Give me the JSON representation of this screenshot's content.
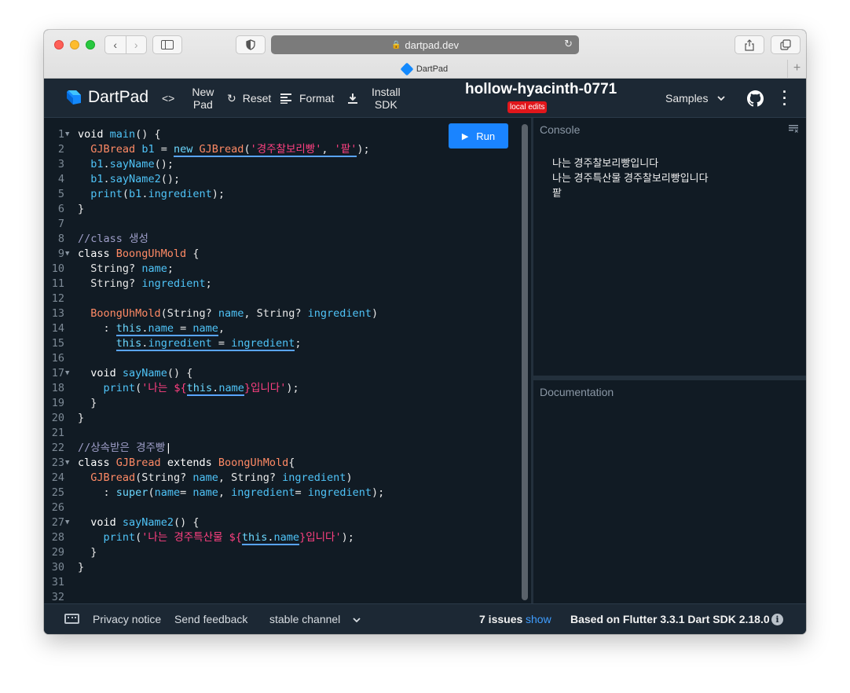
{
  "browser": {
    "url": "dartpad.dev",
    "tab_title": "DartPad",
    "new_tab_label": "+"
  },
  "appbar": {
    "logo_text": "DartPad",
    "new_pad_line1": "New",
    "new_pad_line2": "Pad",
    "reset_label": "Reset",
    "format_label": "Format",
    "install_line1": "Install",
    "install_line2": "SDK",
    "project_name": "hollow-hyacinth-0771",
    "badge": "local edits",
    "samples_label": "Samples"
  },
  "editor": {
    "run_label": "Run",
    "line_numbers": [
      "1",
      "2",
      "3",
      "4",
      "5",
      "6",
      "7",
      "8",
      "9",
      "10",
      "11",
      "12",
      "13",
      "14",
      "15",
      "16",
      "17",
      "18",
      "19",
      "20",
      "21",
      "22",
      "23",
      "24",
      "25",
      "26",
      "27",
      "28",
      "29",
      "30",
      "31",
      "32"
    ]
  },
  "code": {
    "l1": [
      "void",
      "main",
      "() {"
    ],
    "l2": [
      "GJBread",
      "b1",
      "=",
      "new",
      "GJBread",
      "(",
      "'경주찰보리빵'",
      ",",
      "'팥'",
      ");"
    ],
    "l3": [
      "b1",
      ".",
      "sayName",
      "();"
    ],
    "l4": [
      "b1",
      ".",
      "sayName2",
      "();"
    ],
    "l5": [
      "print",
      "(",
      "b1",
      ".",
      "ingredient",
      ");"
    ],
    "l6": "}",
    "l8": "//class 생성",
    "l9": [
      "class",
      "BoongUhMold",
      "{"
    ],
    "l10": [
      "String?",
      "name",
      ";"
    ],
    "l11": [
      "String?",
      "ingredient",
      ";"
    ],
    "l13": [
      "BoongUhMold",
      "(String?",
      "name",
      ", String?",
      "ingredient",
      ")"
    ],
    "l14": [
      ":",
      "this",
      ".",
      "name",
      "=",
      "name",
      ","
    ],
    "l15": [
      "this",
      ".",
      "ingredient",
      "=",
      "ingredient",
      ";"
    ],
    "l17": [
      "void",
      "sayName",
      "() {"
    ],
    "l18": [
      "print",
      "(",
      "'나는 ${",
      "this",
      ".",
      "name",
      "}입니다'",
      ");"
    ],
    "l19": "}",
    "l20": "}",
    "l22": "//상속받은 경주빵",
    "l23": [
      "class",
      "GJBread",
      "extends",
      "BoongUhMold",
      "{"
    ],
    "l24": [
      "GJBread",
      "(String?",
      "name",
      ", String?",
      "ingredient",
      ")"
    ],
    "l25": [
      ":",
      "super",
      "(",
      "name",
      "=",
      "name",
      ",",
      "ingredient",
      "=",
      "ingredient",
      ");"
    ],
    "l27": [
      "void",
      "sayName2",
      "() {"
    ],
    "l28": [
      "print",
      "(",
      "'나는 경주특산물 ${",
      "this",
      ".",
      "name",
      "}입니다'",
      ");"
    ],
    "l29": "}",
    "l30": "}"
  },
  "console": {
    "title": "Console",
    "clear_icon": "clear-console-icon",
    "output": [
      "나는 경주찰보리빵입니다",
      "나는 경주특산물 경주찰보리빵입니다",
      "팥"
    ]
  },
  "documentation": {
    "title": "Documentation"
  },
  "footer": {
    "privacy": "Privacy notice",
    "feedback": "Send feedback",
    "channel": "stable channel",
    "issues": "7 issues",
    "show": "show",
    "sdk_info": "Based on Flutter 3.3.1 Dart SDK 2.18.0"
  },
  "colors": {
    "accent": "#1a84ff",
    "badge": "#e1161b",
    "background": "#111b24",
    "chrome": "#1c2834"
  }
}
